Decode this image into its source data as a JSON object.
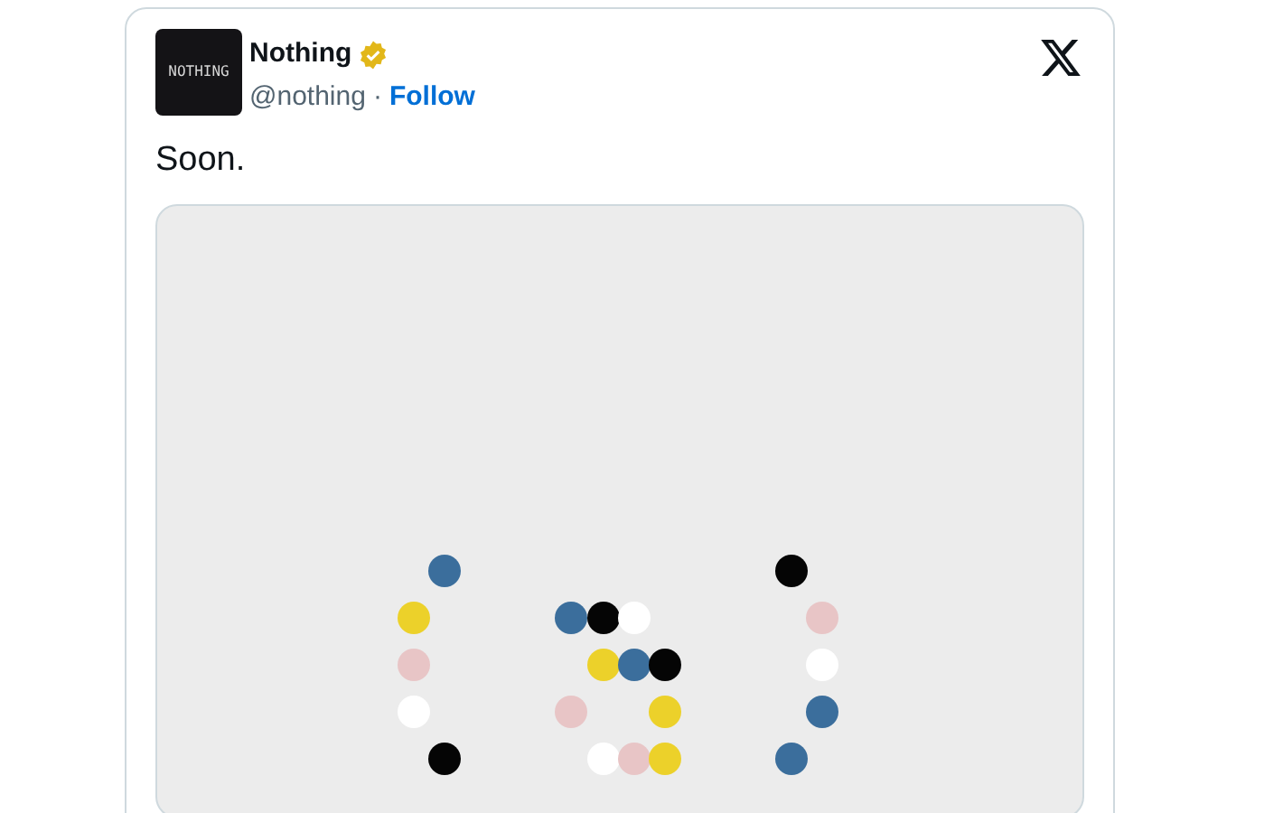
{
  "tweet": {
    "avatar_text": "NOTHING",
    "name": "Nothing",
    "verified": true,
    "handle": "@nothing",
    "separator": "·",
    "follow": "Follow",
    "text": "Soon."
  }
}
